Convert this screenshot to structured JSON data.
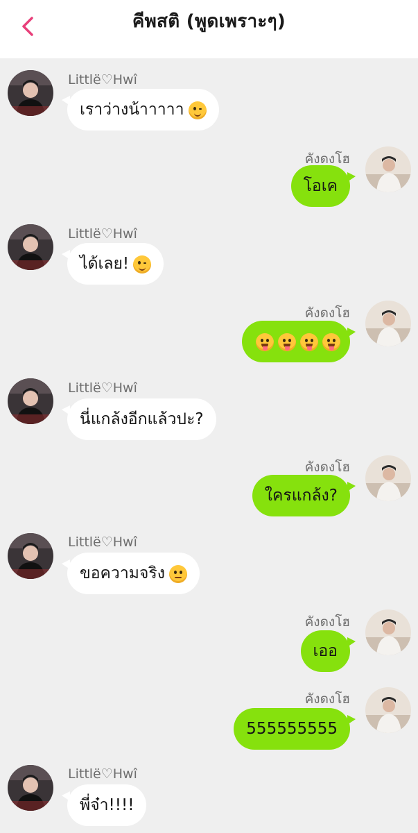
{
  "header": {
    "title": "คีพสติ (พูดเพราะๆ)",
    "back_icon": "chevron-left-icon",
    "accent_color": "#e8407a"
  },
  "colors": {
    "incoming_bubble": "#ffffff",
    "outgoing_bubble": "#86e10d",
    "background": "#efefef"
  },
  "messages": [
    {
      "sender": "Littlë♡Hwî",
      "side": "in",
      "text": "เราว่างน้าาาาา",
      "emoji": "wink-emoji"
    },
    {
      "sender": "คังดงโฮ",
      "side": "out",
      "text": "โอเค",
      "emoji": ""
    },
    {
      "sender": "Littlë♡Hwî",
      "side": "in",
      "text": "ได้เลย!",
      "emoji": "wink-emoji"
    },
    {
      "sender": "คังดงโฮ",
      "side": "out",
      "text": "",
      "emoji": "tongue-emoji x4"
    },
    {
      "sender": "Littlë♡Hwî",
      "side": "in",
      "text": "นี่แกล้งอีกแล้วปะ?",
      "emoji": ""
    },
    {
      "sender": "คังดงโฮ",
      "side": "out",
      "text": "ใครแกล้ง?",
      "emoji": ""
    },
    {
      "sender": "Littlë♡Hwî",
      "side": "in",
      "text": "ขอความจริง",
      "emoji": "neutral-emoji"
    },
    {
      "sender": "คังดงโฮ",
      "side": "out",
      "text": "เออ",
      "emoji": ""
    },
    {
      "sender": "คังดงโฮ",
      "side": "out",
      "text": "555555555",
      "emoji": ""
    },
    {
      "sender": "Littlë♡Hwî",
      "side": "in",
      "text": "พี่จ๋า!!!!",
      "emoji": ""
    }
  ]
}
